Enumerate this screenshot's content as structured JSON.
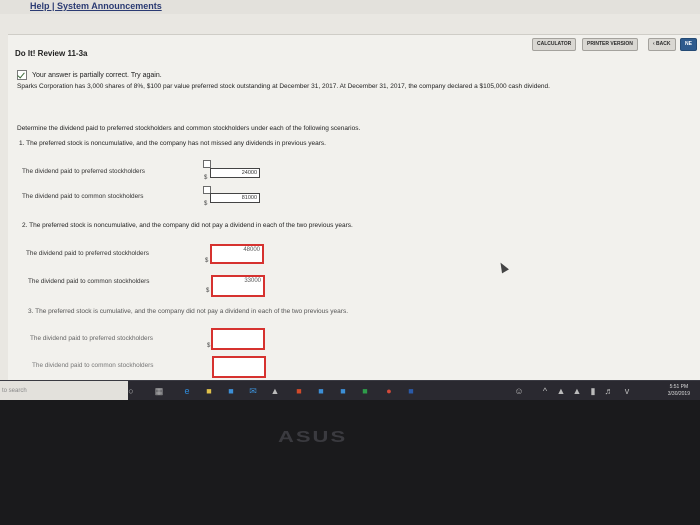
{
  "browser": {
    "tab_link": "Help | System Announcements"
  },
  "toolbar": {
    "calculator": "CALCULATOR",
    "printer": "PRINTER VERSION",
    "back": "‹ BACK",
    "next": "NE"
  },
  "problem": {
    "title": "Do It! Review 11-3a",
    "feedback": "Your answer is partially correct.  Try again.",
    "intro": "Sparks Corporation has 3,000 shares of 8%, $100 par value preferred stock outstanding at December 31, 2017. At December 31, 2017, the company declared a $105,000 cash dividend.",
    "instruction": "Determine the dividend paid to preferred stockholders and common stockholders under each of the following scenarios.",
    "scenario1": {
      "text": "1. The preferred stock is noncumulative, and the company has not missed any dividends in previous years.",
      "preferred_label": "The dividend paid to preferred stockholders",
      "preferred_value": "24000",
      "common_label": "The dividend paid to common stockholders",
      "common_value": "81000"
    },
    "scenario2": {
      "text": "2. The preferred stock is noncumulative, and the company did not pay a dividend in each of the two previous years.",
      "preferred_label": "The dividend paid to preferred stockholders",
      "preferred_value": "48000",
      "common_label": "The dividend paid to common stockholders",
      "common_value": "33000"
    },
    "scenario3": {
      "text": "3. The preferred stock is cumulative, and the company did not pay a dividend in each of the two previous years.",
      "preferred_label": "The dividend paid to preferred stockholders",
      "preferred_value": "",
      "common_label": "The dividend paid to common stockholders",
      "common_value": ""
    },
    "currency": "$"
  },
  "taskbar": {
    "search": "to search",
    "time": "5:51 PM",
    "date": "3/30/2019"
  },
  "brand": "ASUS",
  "colors": {
    "error_border": "#d6322f",
    "next_button": "#2f5b8d"
  }
}
